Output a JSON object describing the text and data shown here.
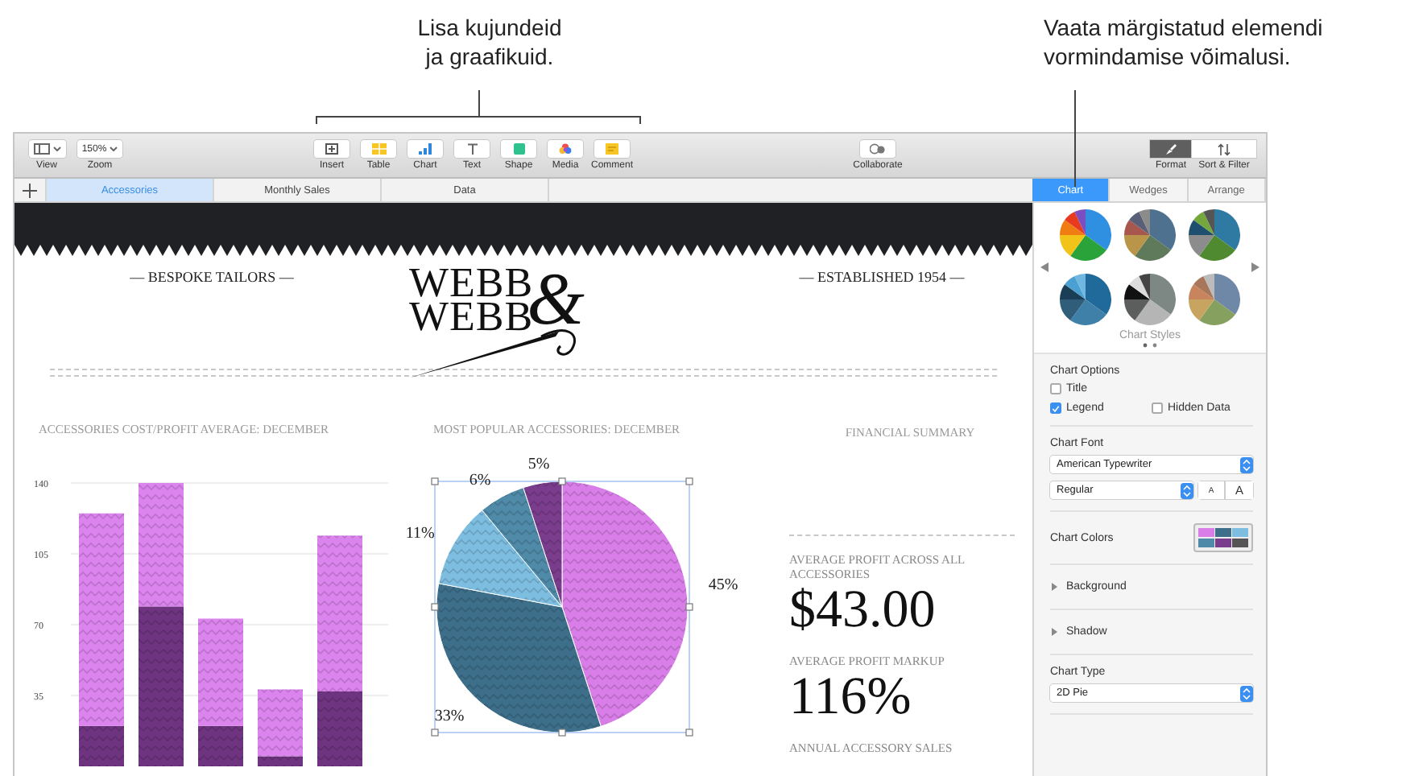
{
  "callouts": [
    {
      "text": "Lisa kujundeid ja graafikuid."
    },
    {
      "text": "Vaata märgistatud elemendi vormindamise võimalusi."
    }
  ],
  "toolbar": {
    "left": [
      {
        "kind": "view",
        "label": "View"
      },
      {
        "kind": "zoom",
        "label": "Zoom",
        "value": "150%"
      }
    ],
    "insert": [
      {
        "kind": "insert",
        "label": "Insert"
      },
      {
        "kind": "table",
        "label": "Table"
      },
      {
        "kind": "chart",
        "label": "Chart"
      },
      {
        "kind": "text",
        "label": "Text"
      },
      {
        "kind": "shape",
        "label": "Shape"
      },
      {
        "kind": "media",
        "label": "Media"
      },
      {
        "kind": "comment",
        "label": "Comment"
      }
    ],
    "collaborate": {
      "label": "Collaborate"
    },
    "right": [
      {
        "kind": "format",
        "label": "Format",
        "selected": true
      },
      {
        "kind": "sort",
        "label": "Sort & Filter",
        "selected": false
      }
    ]
  },
  "sheet_tabs": [
    {
      "label": "Accessories",
      "selected": true
    },
    {
      "label": "Monthly Sales",
      "selected": false
    },
    {
      "label": "Data",
      "selected": false
    }
  ],
  "canvas": {
    "header": {
      "left": "— BESPOKE TAILORS —",
      "logo_lines": [
        "WEBB",
        "WEBB"
      ],
      "logo_ampersand": "&",
      "right": "— ESTABLISHED 1954 —"
    },
    "bar_section": {
      "title": "ACCESSORIES COST/PROFIT AVERAGE: DECEMBER",
      "chart_data": {
        "type": "bar",
        "stacked": true,
        "grid": true,
        "ylim": [
          0,
          140
        ],
        "yticks": [
          35,
          70,
          105,
          140
        ],
        "series": [
          {
            "color": "#6e3480",
            "values": [
              20,
              79,
              20,
              5,
              37
            ]
          },
          {
            "color": "#dc84ee",
            "values": [
              105,
              61,
              53,
              33,
              77
            ]
          }
        ]
      }
    },
    "pie_section": {
      "title": "MOST POPULAR ACCESSORIES: DECEMBER",
      "chart_data": {
        "type": "pie",
        "values": [
          45,
          33,
          11,
          6,
          5
        ],
        "value_labels": [
          "45%",
          "33%",
          "11%",
          "6%",
          "5%"
        ]
      }
    },
    "summary": {
      "title": "FINANCIAL SUMMARY",
      "stats": [
        {
          "label": "AVERAGE PROFIT ACROSS ALL ACCESSORIES",
          "value": "$43.00"
        },
        {
          "label": "AVERAGE PROFIT MARKUP",
          "value": "116%"
        },
        {
          "label": "ANNUAL ACCESSORY SALES"
        }
      ]
    }
  },
  "inspector": {
    "tabs": [
      {
        "label": "Chart",
        "selected": true
      },
      {
        "label": "Wedges",
        "selected": false
      },
      {
        "label": "Arrange",
        "selected": false
      }
    ],
    "styles_label": "Chart Styles",
    "options": {
      "title": "Chart Options",
      "checkboxes": [
        {
          "label": "Title",
          "checked": false
        },
        {
          "label": "Legend",
          "checked": true
        },
        {
          "label": "Hidden Data",
          "checked": false
        }
      ]
    },
    "font": {
      "title": "Chart Font",
      "family": "American Typewriter",
      "style": "Regular",
      "size_buttons": [
        "A",
        "A"
      ]
    },
    "colors": {
      "title": "Chart Colors"
    },
    "disclosures": [
      {
        "label": "Background",
        "expanded": false
      },
      {
        "label": "Shadow",
        "expanded": false
      }
    ],
    "type": {
      "title": "Chart Type",
      "value": "2D Pie"
    }
  }
}
